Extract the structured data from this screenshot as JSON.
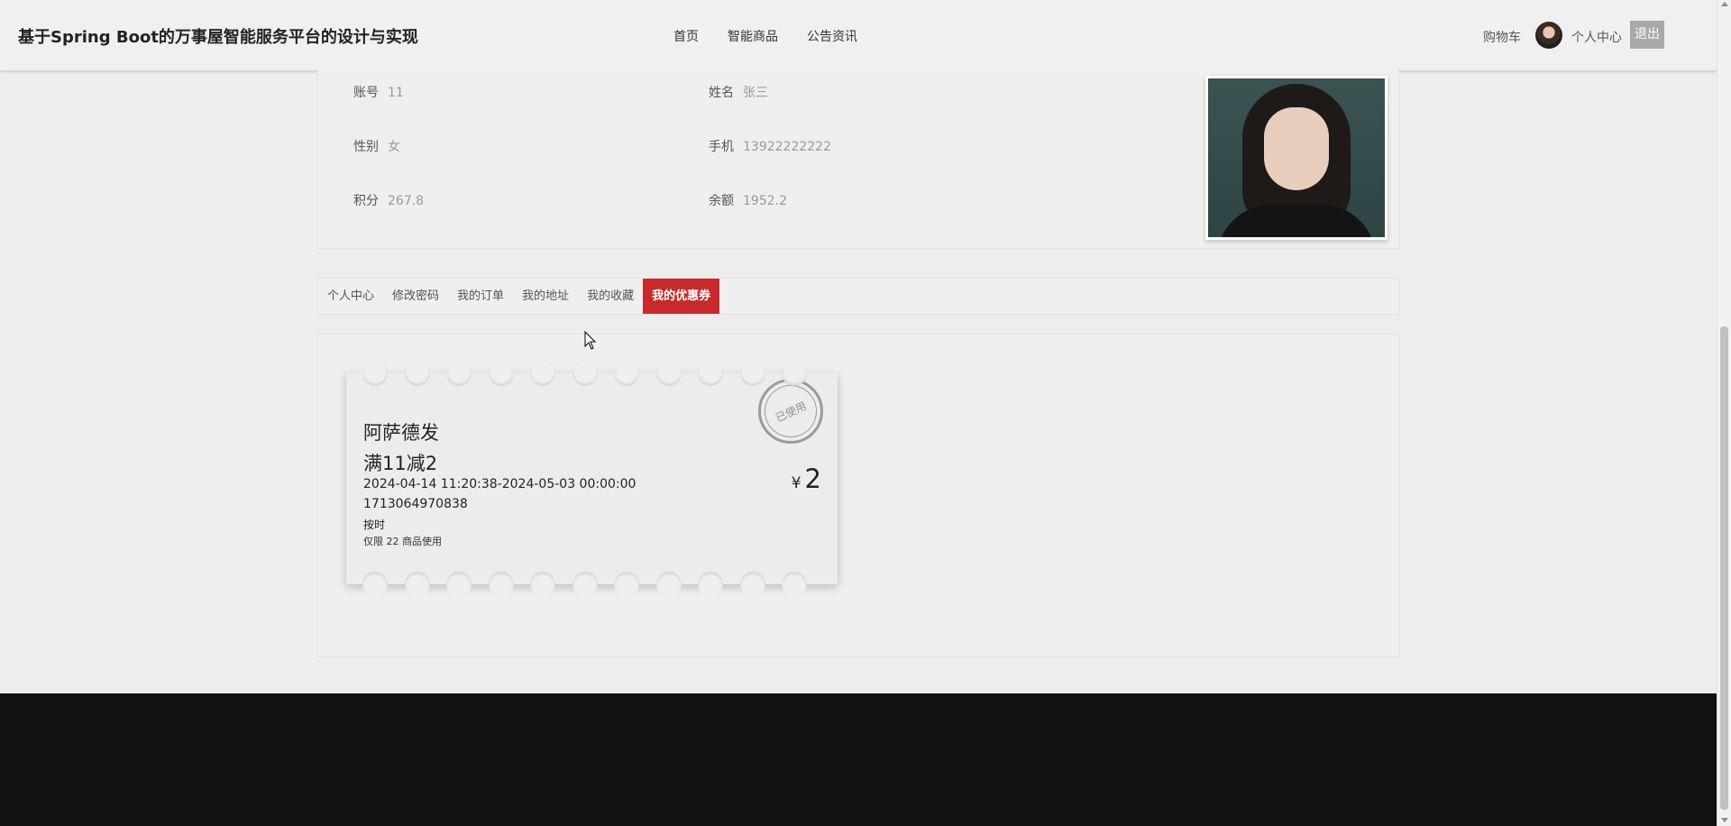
{
  "header": {
    "site_title": "基于Spring Boot的万事屋智能服务平台的设计与实现",
    "nav": [
      "首页",
      "智能商品",
      "公告资讯"
    ],
    "cart": "购物车",
    "profile": "个人中心",
    "logout": "退出"
  },
  "profile": {
    "account_label": "账号",
    "account": "11",
    "name_label": "姓名",
    "name": "张三",
    "gender_label": "性别",
    "gender": "女",
    "phone_label": "手机",
    "phone": "13922222222",
    "points_label": "积分",
    "points": "267.8",
    "balance_label": "余额",
    "balance": "1952.2"
  },
  "tabs": [
    "个人中心",
    "修改密码",
    "我的订单",
    "我的地址",
    "我的收藏",
    "我的优惠券"
  ],
  "active_tab": "我的优惠券",
  "coupon": {
    "name": "阿萨德发",
    "rule": "满11减2",
    "validity": "2024-04-14 11:20:38-2024-05-03 00:00:00",
    "code": "1713064970838",
    "type": "按时",
    "limit": "仅限 22 商品使用",
    "currency": "¥",
    "amount": "2",
    "stamp": "已使用"
  },
  "colors": {
    "accent": "#c62a2a",
    "footer": "#111111",
    "background": "#ededed"
  }
}
